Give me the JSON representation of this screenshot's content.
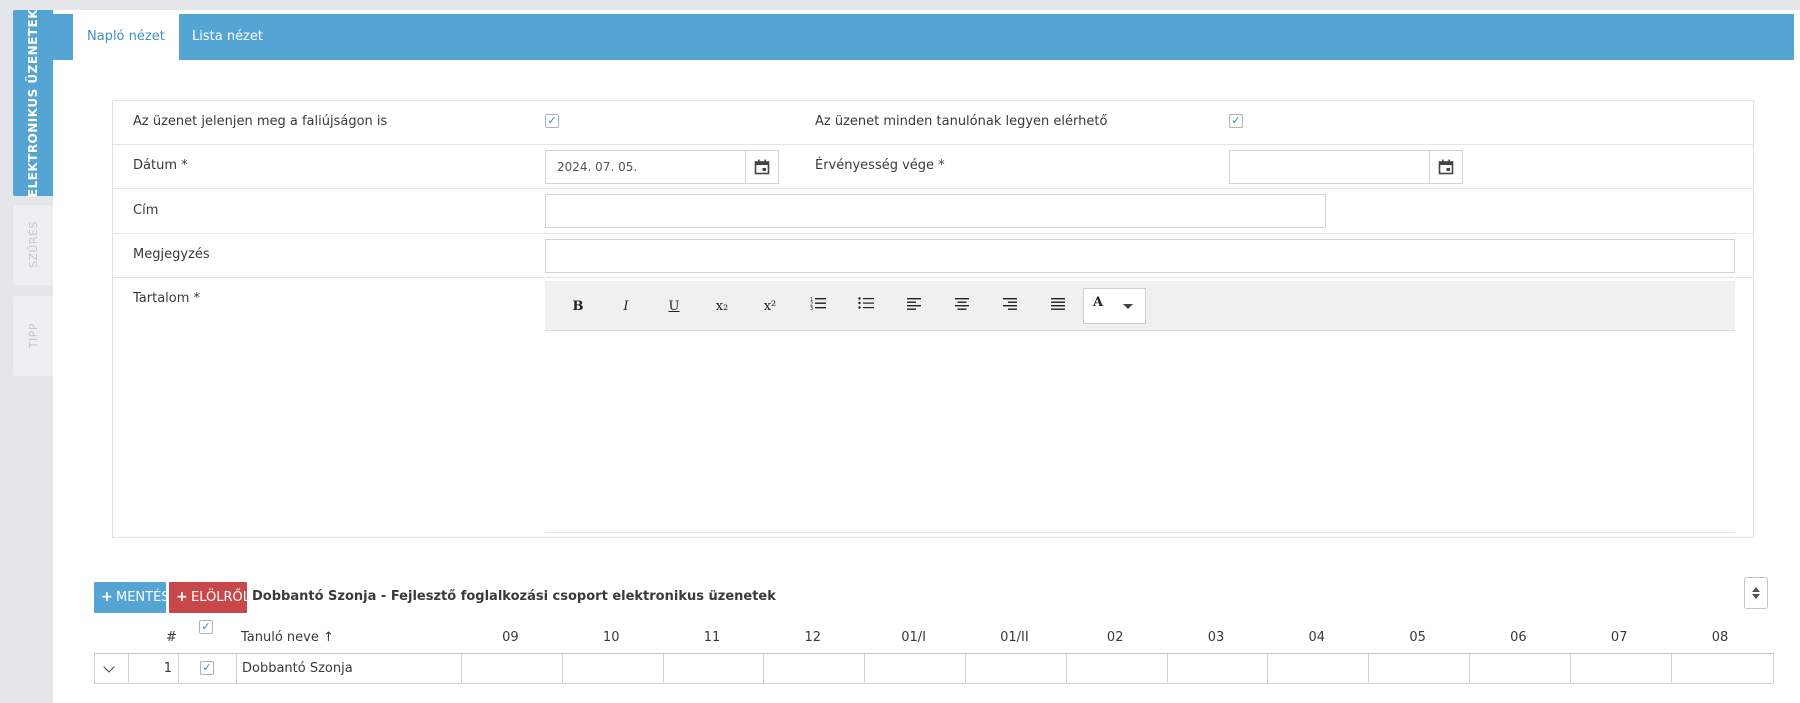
{
  "sidebar": {
    "tabs": [
      {
        "label": "ELEKTRONIKUS ÜZENETEK"
      },
      {
        "label": "SZŰRÉS"
      },
      {
        "label": "TIPP"
      }
    ]
  },
  "nav": {
    "tabs": [
      {
        "label": "Napló nézet"
      },
      {
        "label": "Lista nézet"
      }
    ]
  },
  "form": {
    "faliujsag_label": "Az üzenet jelenjen meg a faliújságon is",
    "faliujsag_checked": true,
    "minden_tanulo_label": "Az üzenet minden tanulónak legyen elérhető",
    "minden_tanulo_checked": true,
    "datum_label": "Dátum *",
    "datum_value": "2024. 07. 05.",
    "ervenyesseg_label": "Érvényesség vége *",
    "ervenyesseg_value": "",
    "cim_label": "Cím",
    "cim_value": "",
    "megjegyzes_label": "Megjegyzés",
    "megjegyzes_value": "",
    "tartalom_label": "Tartalom *"
  },
  "toolbar": {
    "bold": "B",
    "italic": "I",
    "underline": "U",
    "subscript": "x₂",
    "superscript": "x²",
    "font_color": "A",
    "icons": [
      "bold-icon",
      "italic-icon",
      "underline-icon",
      "subscript-icon",
      "superscript-icon",
      "ordered-list-icon",
      "unordered-list-icon",
      "align-left-icon",
      "align-center-icon",
      "align-right-icon",
      "align-justify-icon",
      "font-color-icon"
    ]
  },
  "actions": {
    "save_label": "MENTÉS",
    "reset_label": "ELÖLRŐL",
    "title": "Dobbantó Szonja - Fejlesztő foglalkozási csoport elektronikus üzenetek"
  },
  "table": {
    "col_number": "#",
    "col_name": "Tanuló neve",
    "sort_arrow": "↑",
    "months": [
      "09",
      "10",
      "11",
      "12",
      "01/I",
      "01/II",
      "02",
      "03",
      "04",
      "05",
      "06",
      "07",
      "08"
    ],
    "rows": [
      {
        "index": "1",
        "checked": true,
        "name": "Dobbantó Szonja",
        "months": [
          "",
          "",
          "",
          "",
          "",
          "",
          "",
          "",
          "",
          "",
          "",
          "",
          ""
        ]
      }
    ]
  },
  "colors": {
    "accent": "#54a5d4",
    "danger": "#c8484a"
  }
}
